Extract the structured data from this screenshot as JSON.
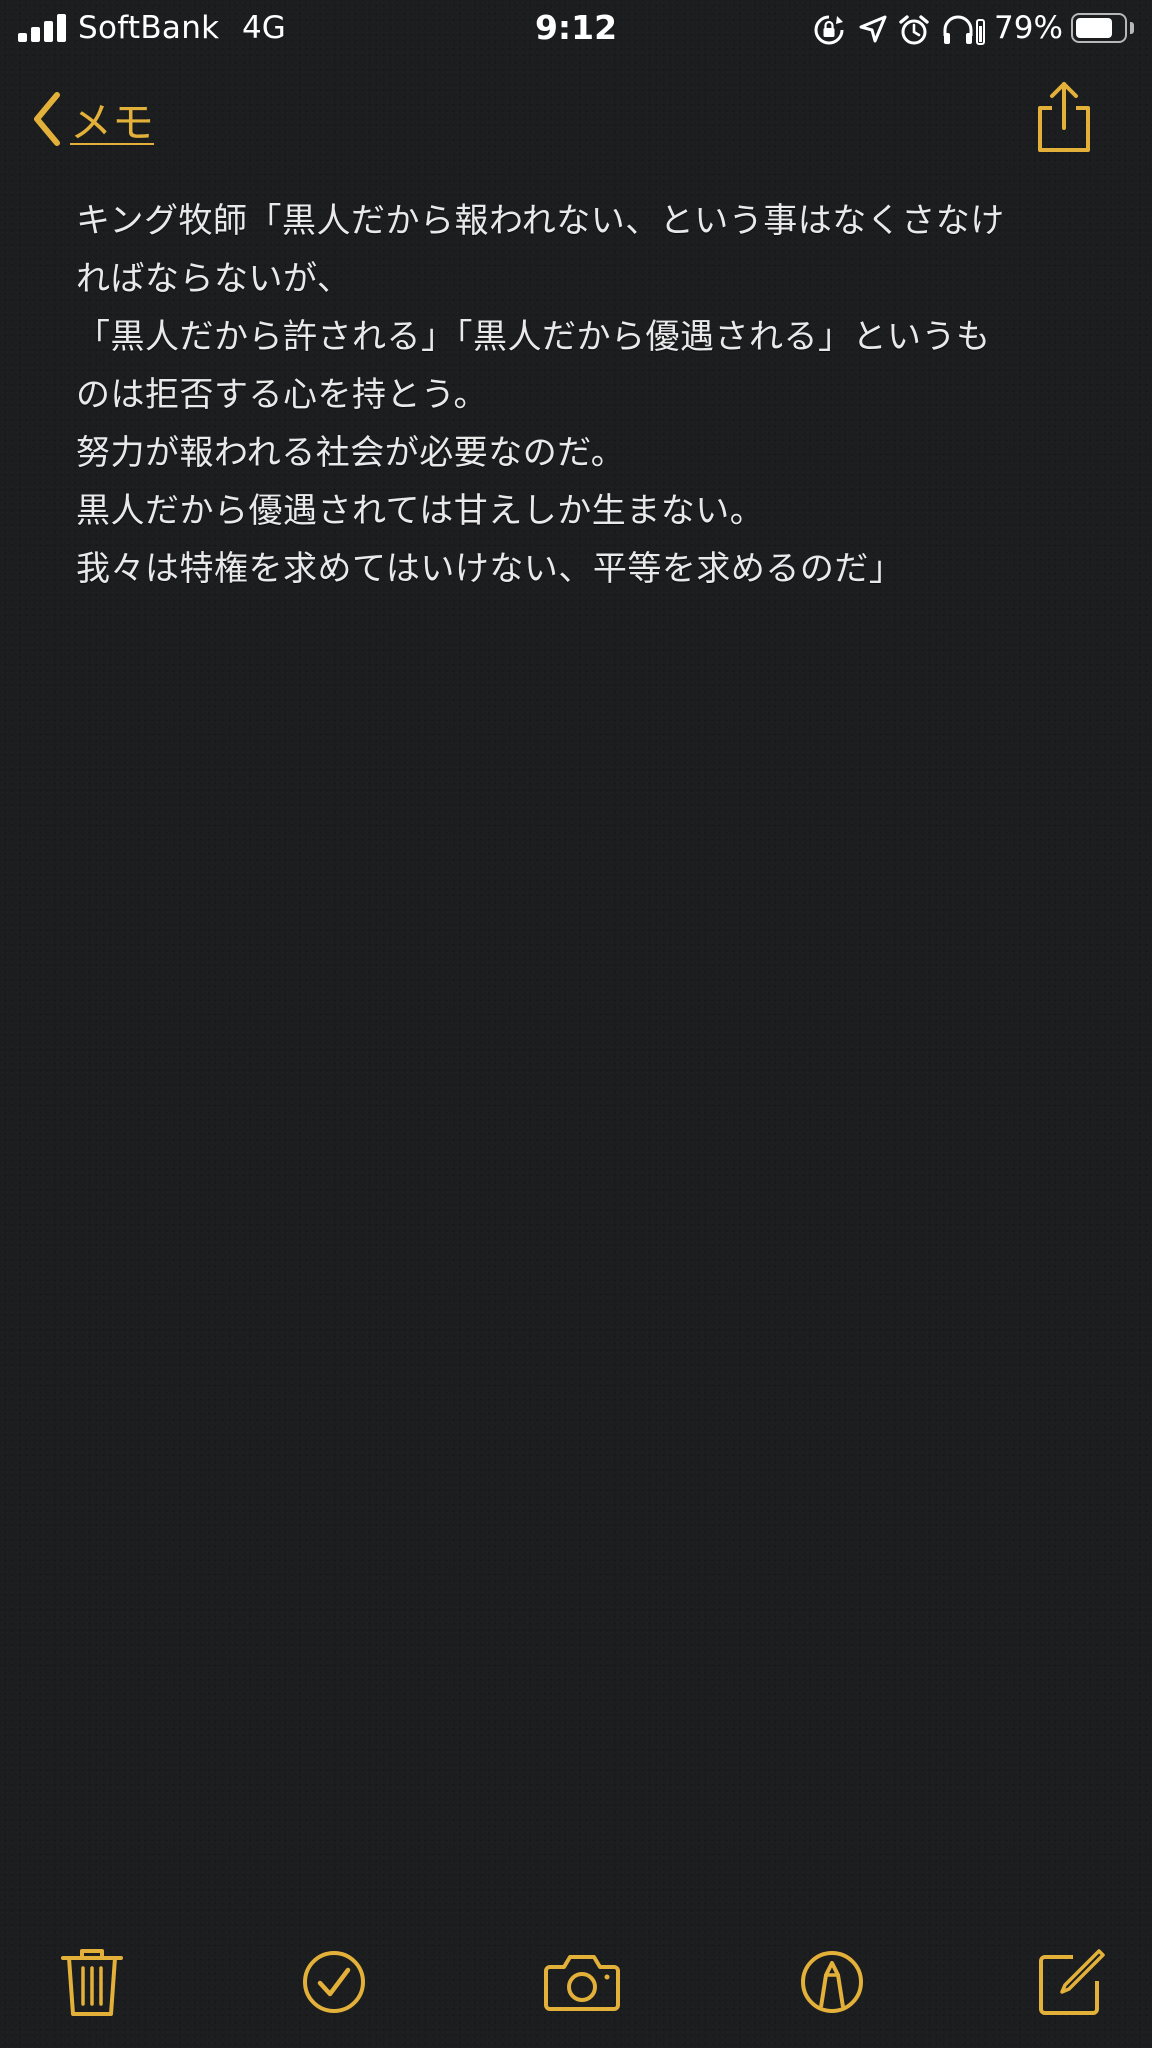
{
  "status_bar": {
    "carrier": "SoftBank",
    "network": "4G",
    "time": "9:12",
    "battery_percent": "79%",
    "battery_level": 0.79,
    "icons": [
      "signal-bars-icon",
      "rotation-lock-icon",
      "location-arrow-icon",
      "alarm-clock-icon",
      "headphones-icon",
      "battery-icon"
    ]
  },
  "nav": {
    "back_label": "メモ",
    "back_icon": "chevron-left-icon",
    "share_icon": "share-icon"
  },
  "note": {
    "lines": [
      "キング牧師「黒人だから報われない、という事はなくさなけ",
      "ればならないが、",
      "「黒人だから許される」「黒人だから優遇される」というも",
      "のは拒否する心を持とう。",
      "努力が報われる社会が必要なのだ。",
      "黒人だから優遇されては甘えしか生まない。",
      "我々は特権を求めてはいけない、平等を求めるのだ」"
    ]
  },
  "toolbar": {
    "icons": [
      "trash-icon",
      "checklist-icon",
      "camera-icon",
      "markup-pen-icon",
      "compose-icon"
    ]
  },
  "colors": {
    "accent": "#e3b13a",
    "background": "#1c1d1f",
    "text": "#e9e9e9"
  }
}
